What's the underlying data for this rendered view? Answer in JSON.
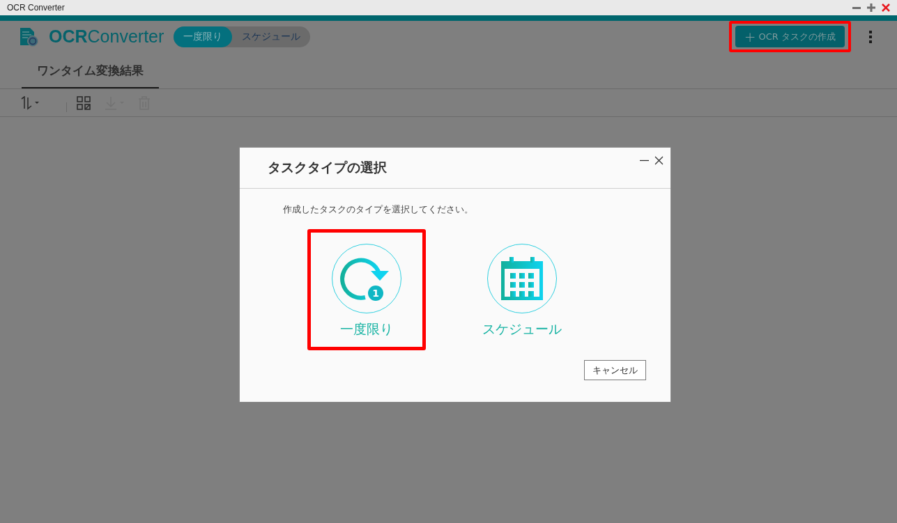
{
  "window": {
    "title": "OCR Converter"
  },
  "header": {
    "logo_bold": "OCR",
    "logo_light": "Converter",
    "mode_switch": [
      {
        "label": "一度限り",
        "selected": true
      },
      {
        "label": "スケジュール",
        "selected": false
      }
    ],
    "create_button": {
      "icon": "+",
      "label": "OCR タスクの作成",
      "highlighted": true
    }
  },
  "tabs": [
    {
      "label": "ワンタイム変換結果",
      "selected": true
    }
  ],
  "toolbar": [
    {
      "kind": "sort",
      "disabled": false
    },
    {
      "kind": "grid",
      "disabled": false
    },
    {
      "kind": "download",
      "disabled": true
    },
    {
      "kind": "trash",
      "disabled": true
    }
  ],
  "dialog": {
    "title": "タスクタイプの選択",
    "message": "作成したタスクのタイプを選択してください。",
    "options": [
      {
        "kind": "once",
        "label": "一度限り",
        "badge": "1",
        "highlighted": true
      },
      {
        "kind": "schedule",
        "label": "スケジュール",
        "highlighted": false
      }
    ],
    "cancel_button": "キャンセル"
  }
}
